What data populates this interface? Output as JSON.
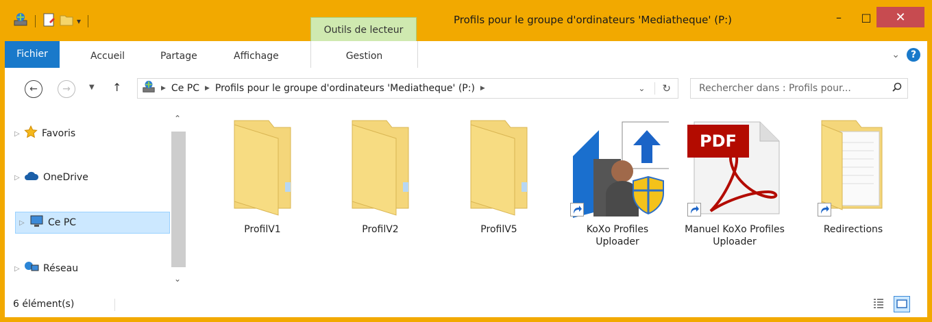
{
  "titlebar": {
    "title": "Profils pour le groupe d'ordinateurs 'Mediatheque' (P:)",
    "context_tab": "Outils de lecteur",
    "minimize": "–",
    "maximize": "□",
    "close": "✕"
  },
  "ribbon": {
    "tabs": [
      "Fichier",
      "Accueil",
      "Partage",
      "Affichage",
      "Gestion"
    ],
    "help": "?"
  },
  "address": {
    "segments": [
      "Ce PC",
      "Profils pour le groupe d'ordinateurs 'Mediatheque' (P:)"
    ],
    "search_placeholder": "Rechercher dans : Profils pour..."
  },
  "nav": {
    "items": [
      {
        "label": "Favoris",
        "icon": "star-icon"
      },
      {
        "label": "OneDrive",
        "icon": "cloud-icon"
      },
      {
        "label": "Ce PC",
        "icon": "computer-icon"
      },
      {
        "label": "Réseau",
        "icon": "network-icon"
      }
    ]
  },
  "files": [
    {
      "name": "ProfilV1",
      "icon": "folder-icon"
    },
    {
      "name": "ProfilV2",
      "icon": "folder-icon"
    },
    {
      "name": "ProfilV5",
      "icon": "folder-icon"
    },
    {
      "name": "KoXo Profiles Uploader",
      "icon": "app-shortcut-icon"
    },
    {
      "name": "Manuel KoXo Profiles Uploader",
      "icon": "pdf-icon",
      "pdf_text": "PDF"
    },
    {
      "name": "Redirections",
      "icon": "folder-shortcut-icon"
    }
  ],
  "status": {
    "count": "6 élément(s)"
  },
  "colors": {
    "titlebar": "#f2a900",
    "file_tab": "#1979ca",
    "close": "#c74b50",
    "context_tab": "#cfe9b0",
    "selected": "#cce8ff"
  }
}
